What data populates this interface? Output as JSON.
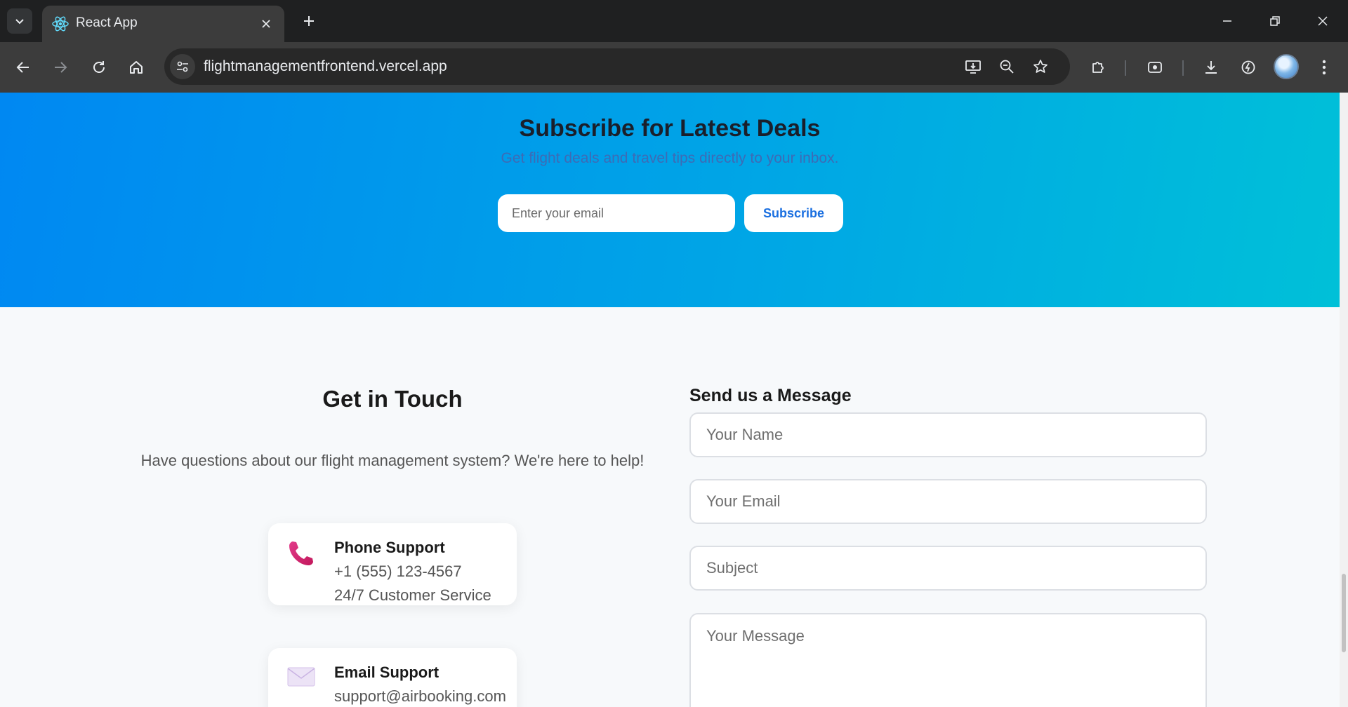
{
  "browser": {
    "tab_title": "React App",
    "url": "flightmanagementfrontend.vercel.app"
  },
  "newsletter": {
    "title": "Subscribe for Latest Deals",
    "subtitle": "Get flight deals and travel tips directly to your inbox.",
    "email_placeholder": "Enter your email",
    "button_label": "Subscribe"
  },
  "contact": {
    "title": "Get in Touch",
    "subtitle": "Have questions about our flight management system? We're here to help!",
    "cards": [
      {
        "icon": "phone-icon",
        "title": "Phone Support",
        "line1": "+1 (555) 123-4567",
        "line2": "24/7 Customer Service"
      },
      {
        "icon": "envelope-icon",
        "title": "Email Support",
        "line1": "support@airbooking.com"
      }
    ]
  },
  "form": {
    "title": "Send us a Message",
    "name_placeholder": "Your Name",
    "email_placeholder": "Your Email",
    "subject_placeholder": "Subject",
    "message_placeholder": "Your Message"
  },
  "colors": {
    "hero_gradient_start": "#0088f2",
    "hero_gradient_end": "#00c0d8",
    "accent": "#1a6fe0",
    "phone_icon": "#d63384"
  }
}
